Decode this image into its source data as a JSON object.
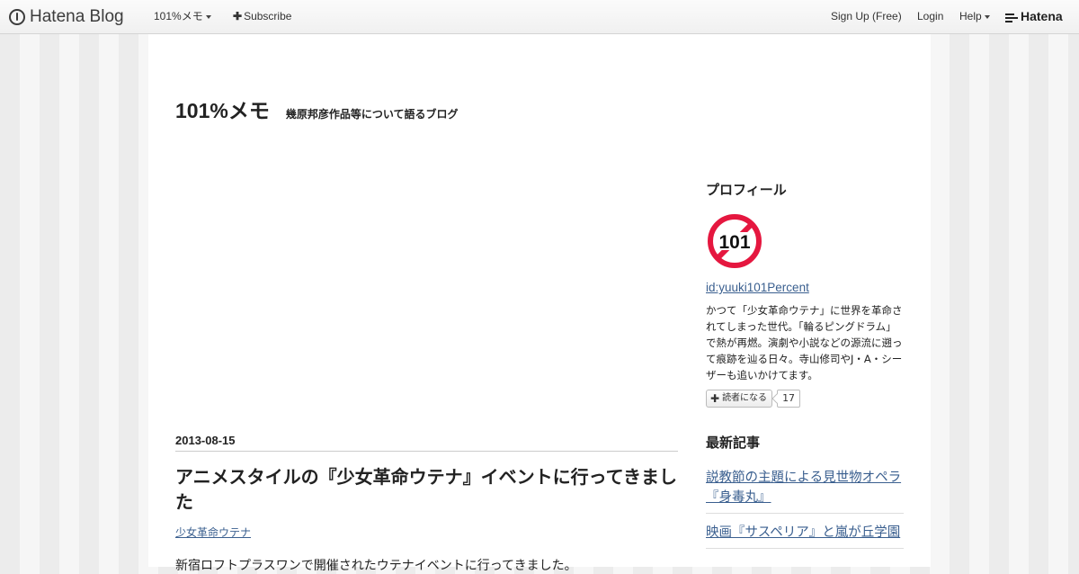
{
  "global_header": {
    "brand": "Hatena Blog",
    "blog_menu": "101%メモ",
    "subscribe": "Subscribe",
    "signup": "Sign Up (Free)",
    "login": "Login",
    "help": "Help",
    "hatena": "Hatena"
  },
  "blog": {
    "title": "101%メモ",
    "description": "幾原邦彦作品等について語るブログ"
  },
  "entry": {
    "date": "2013-08-15",
    "title": "アニメスタイルの『少女革命ウテナ』イベントに行ってきました",
    "category": "少女革命ウテナ",
    "body_start": "新宿ロフトプラスワンで開催されたウテナイベントに行ってきました。"
  },
  "sidebar": {
    "profile": {
      "heading": "プロフィール",
      "avatar_text": "101",
      "id": "id:yuuki101Percent",
      "bio": "かつて「少女革命ウテナ」に世界を革命されてしまった世代。「輪るピングドラム」で熱が再燃。演劇や小説などの源流に遡って痕跡を辿る日々。寺山修司やJ・A・シーザーも追いかけてます。",
      "subscribe_label": "読者になる",
      "reader_count": "17"
    },
    "recent": {
      "heading": "最新記事",
      "items": [
        "説教節の主題による見世物オペラ『身毒丸』",
        "映画『サスペリア』と嵐が丘学園"
      ]
    }
  },
  "colors": {
    "link": "#3a5f8f",
    "avatar_red": "#e5173f"
  }
}
